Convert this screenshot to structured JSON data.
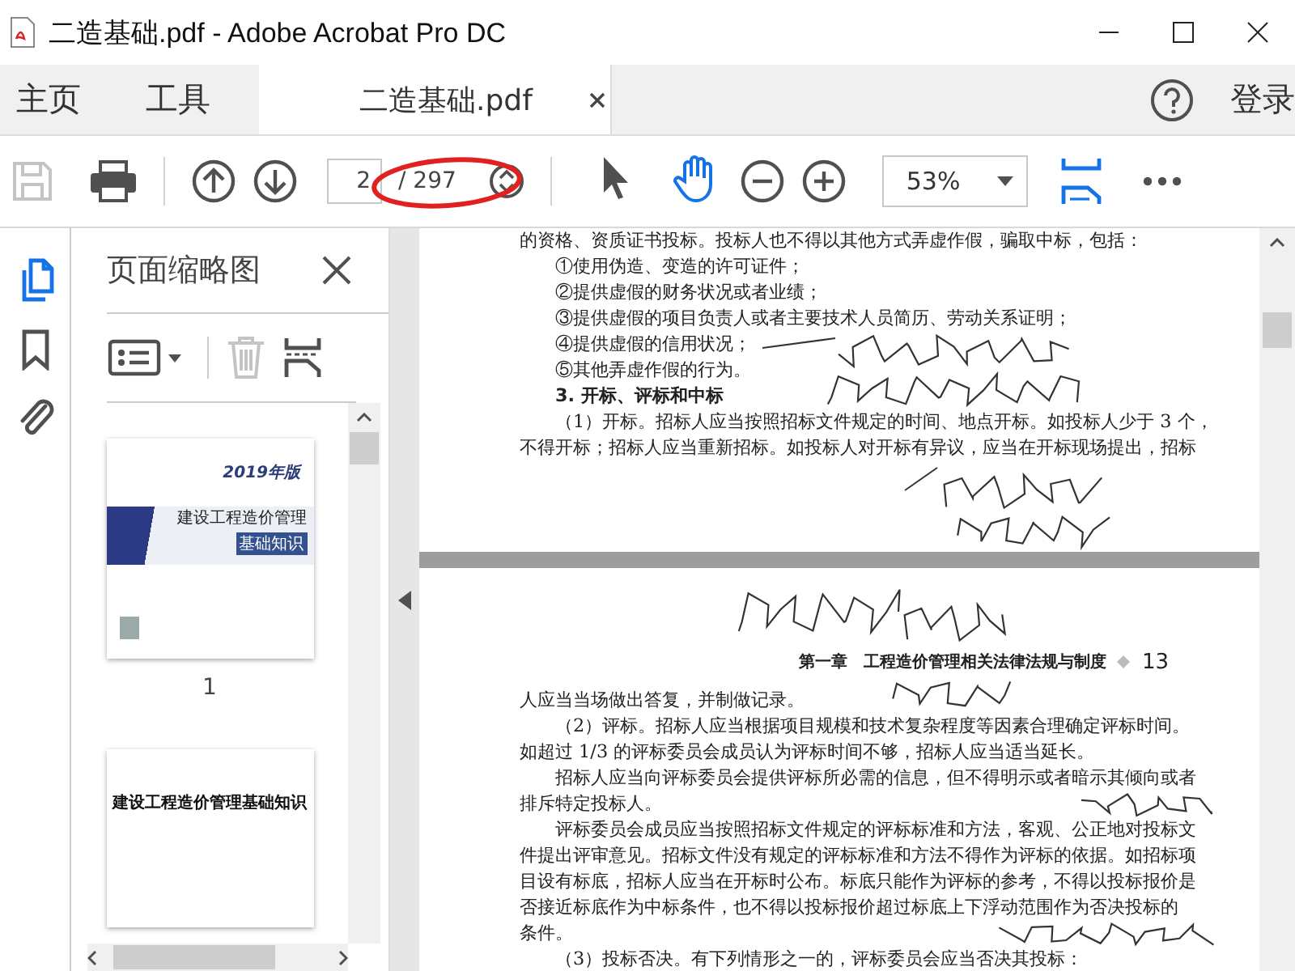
{
  "window": {
    "title": "二造基础.pdf - Adobe Acrobat Pro DC"
  },
  "nav": [
    {
      "label": "主页"
    },
    {
      "label": "工具"
    }
  ],
  "doc_tab": {
    "label": "二造基础.pdf",
    "selected": true
  },
  "sign_in": "登录",
  "toolbar": {
    "save_disabled": true,
    "page_field": "2",
    "page_total": "/ 297",
    "zoom": "53%",
    "tools": [
      {
        "kind": "pointer",
        "selected": false
      },
      {
        "kind": "hand",
        "selected": true
      }
    ]
  },
  "rail": [
    {
      "kind": "pages",
      "selected": true
    },
    {
      "kind": "bookmarks",
      "selected": false
    },
    {
      "kind": "attachments",
      "selected": false
    }
  ],
  "panel": {
    "title": "页面缩略图",
    "delete_disabled": true,
    "thumbnails": [
      {
        "kind": "cover",
        "label": "1",
        "year": "2019年版",
        "title": "建设工程造价管理",
        "subtitle": "基础知识"
      },
      {
        "kind": "title_page",
        "title": "建设工程造价管理基础知识"
      }
    ]
  },
  "pages": [
    {
      "lines": [
        {
          "kind": "cont",
          "text": "的资格、资质证书投标。投标人也不得以其他方式弄虚作假，骗取中标，包括："
        },
        {
          "kind": "first",
          "text": "①使用伪造、变造的许可证件；"
        },
        {
          "kind": "first",
          "text": "②提供虚假的财务状况或者业绩；"
        },
        {
          "kind": "first",
          "text": "③提供虚假的项目负责人或者主要技术人员简历、劳动关系证明；"
        },
        {
          "kind": "first",
          "text": "④提供虚假的信用状况；"
        },
        {
          "kind": "first",
          "text": "⑤其他弄虚作假的行为。"
        },
        {
          "kind": "heading",
          "text": "3. 开标、评标和中标"
        },
        {
          "kind": "first",
          "text": "（1）开标。招标人应当按照招标文件规定的时间、地点开标。如投标人少于 3 个，"
        },
        {
          "kind": "cont",
          "text": "不得开标；招标人应当重新招标。如投标人对开标有异议，应当在开标现场提出，招标"
        }
      ]
    },
    {
      "header": "第一章　工程造价管理相关法律法规与制度",
      "page_number": "13",
      "lines": [
        {
          "kind": "cont",
          "text": "人应当当场做出答复，并制做记录。"
        },
        {
          "kind": "first",
          "text": "（2）评标。招标人应当根据项目规模和技术复杂程度等因素合理确定评标时间。"
        },
        {
          "kind": "cont",
          "text": "如超过 1/3 的评标委员会成员认为评标时间不够，招标人应当适当延长。"
        },
        {
          "kind": "first",
          "text": "招标人应当向评标委员会提供评标所必需的信息，但不得明示或者暗示其倾向或者"
        },
        {
          "kind": "cont",
          "text": "排斥特定投标人。"
        },
        {
          "kind": "first",
          "text": "评标委员会成员应当按照招标文件规定的评标标准和方法，客观、公正地对投标文"
        },
        {
          "kind": "cont",
          "text": "件提出评审意见。招标文件没有规定的评标标准和方法不得作为评标的依据。如招标项"
        },
        {
          "kind": "cont",
          "text": "目设有标底，招标人应当在开标时公布。标底只能作为评标的参考，不得以投标报价是"
        },
        {
          "kind": "cont",
          "text": "否接近标底作为中标条件，也不得以投标报价超过标底上下浮动范围作为否决投标的"
        },
        {
          "kind": "cont",
          "text": "条件。"
        },
        {
          "kind": "first",
          "text": "（3）投标否决。有下列情形之一的，评标委员会应当否决其投标："
        }
      ]
    }
  ]
}
